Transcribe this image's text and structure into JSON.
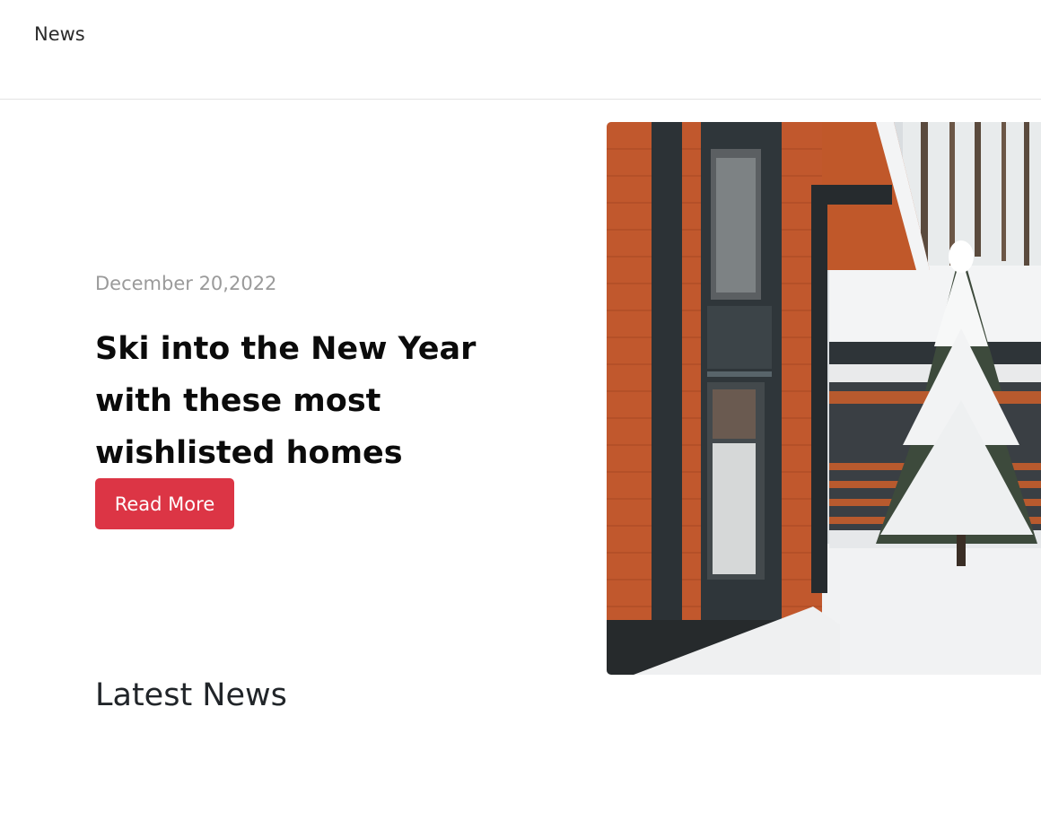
{
  "nav": {
    "link_label": "News"
  },
  "hero": {
    "date": "December 20,2022",
    "title": "Ski into the New Year with these most wishlisted homes",
    "button_label": "Read More",
    "image": "snowy-wooden-house-with-snow-covered-fir-tree"
  },
  "latest": {
    "heading": "Latest News"
  },
  "colors": {
    "accent": "#dc3545",
    "date_text": "#9a9a9a"
  }
}
